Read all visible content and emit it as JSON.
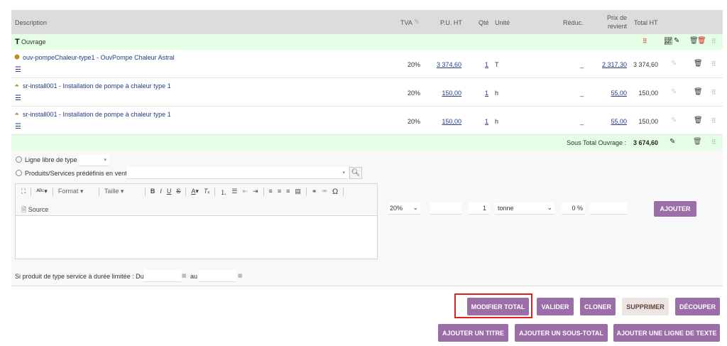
{
  "header": {
    "description": "Description",
    "tva": "TVA",
    "pu_ht": "P.U. HT",
    "qte": "Qté",
    "unite": "Unité",
    "reduc": "Réduc.",
    "prix_revient_1": "Prix de",
    "prix_revient_2": "revient",
    "total_ht": "Total HT"
  },
  "ouvrage": {
    "title": "Ouvrage"
  },
  "rows": [
    {
      "desc": "ouv-pompeChaleur-type1 - OuvPompe Chaleur Astral",
      "tva": "20%",
      "pu": "3 374,60",
      "qte": "1",
      "unite": "T",
      "reduc": "_",
      "prix_revient": "2 317,30",
      "total": "3 374,60"
    },
    {
      "desc": "sr-install001 - Installation de pompe à chaleur type 1",
      "tva": "20%",
      "pu": "150,00",
      "qte": "1",
      "unite": "h",
      "reduc": "_",
      "prix_revient": "55,00",
      "total": "150,00"
    },
    {
      "desc": "sr-install001 - Installation de pompe à chaleur type 1",
      "tva": "20%",
      "pu": "150,00",
      "qte": "1",
      "unite": "h",
      "reduc": "_",
      "prix_revient": "55,00",
      "total": "150,00"
    }
  ],
  "subtotal": {
    "label": "Sous Total Ouvrage :",
    "value": "3 674,60"
  },
  "form": {
    "ligne_libre": "Ligne libre de type",
    "produits": "Produits/Services prédéfinis en vente",
    "format": "Format",
    "taille": "Taille",
    "source": "Source",
    "tva_value": "20%",
    "qty_value": "1",
    "unit_value": "tonne",
    "reduc_value": "0 %",
    "ajouter": "AJOUTER",
    "service_label": "Si produit de type service à durée limitée : Du",
    "au": "au"
  },
  "buttons": {
    "modifier_total": "MODIFIER TOTAL",
    "valider": "VALIDER",
    "cloner": "CLONER",
    "supprimer": "SUPPRIMER",
    "decouper": "DÉCOUPER",
    "ajouter_titre": "AJOUTER UN TITRE",
    "ajouter_sous_total": "AJOUTER UN SOUS-TOTAL",
    "ajouter_ligne_texte": "AJOUTER UNE LIGNE DE TEXTE"
  },
  "colors": {
    "accent": "#9c6ea8",
    "highlight": "#e02020",
    "green_row": "#e4fde4"
  }
}
